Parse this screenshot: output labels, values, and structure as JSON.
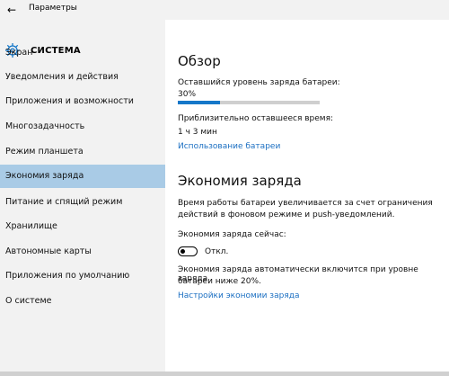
{
  "window": {
    "title": "Параметры"
  },
  "header": {
    "title": "СИСТЕМА"
  },
  "sidebar": {
    "items": [
      {
        "label": "Экран"
      },
      {
        "label": "Уведомления и действия"
      },
      {
        "label": "Приложения и возможности"
      },
      {
        "label": "Многозадачность"
      },
      {
        "label": "Режим планшета"
      },
      {
        "label": "Экономия заряда"
      },
      {
        "label": "Питание и спящий режим"
      },
      {
        "label": "Хранилище"
      },
      {
        "label": "Автономные карты"
      },
      {
        "label": "Приложения по умолчанию"
      },
      {
        "label": "О системе"
      }
    ],
    "active_index": 5
  },
  "overview": {
    "heading": "Обзор",
    "battery_label": "Оставшийся уровень заряда батареи:",
    "battery_value": "30%",
    "battery_fraction": 0.3,
    "time_label": "Приблизительно оставшееся время:",
    "time_value": "1 ч 3 мин",
    "usage_link": "Использование батареи"
  },
  "saver": {
    "heading": "Экономия заряда",
    "description_line1": "Время работы батареи увеличивается за счет ограничения",
    "description_line2": "действий в фоновом режиме и push-уведомлений.",
    "status_label": "Экономия заряда сейчас:",
    "toggle_state": "Откл.",
    "auto_line1": "Экономия заряда автоматически включится при уровне заряда",
    "auto_line2": "батареи ниже 20%.",
    "settings_link": "Настройки экономии заряда"
  },
  "colors": {
    "accent": "#1577c9",
    "link": "#1b6fc2",
    "sidebar_bg": "#f2f2f2",
    "active_bg": "#a9cbe6"
  }
}
